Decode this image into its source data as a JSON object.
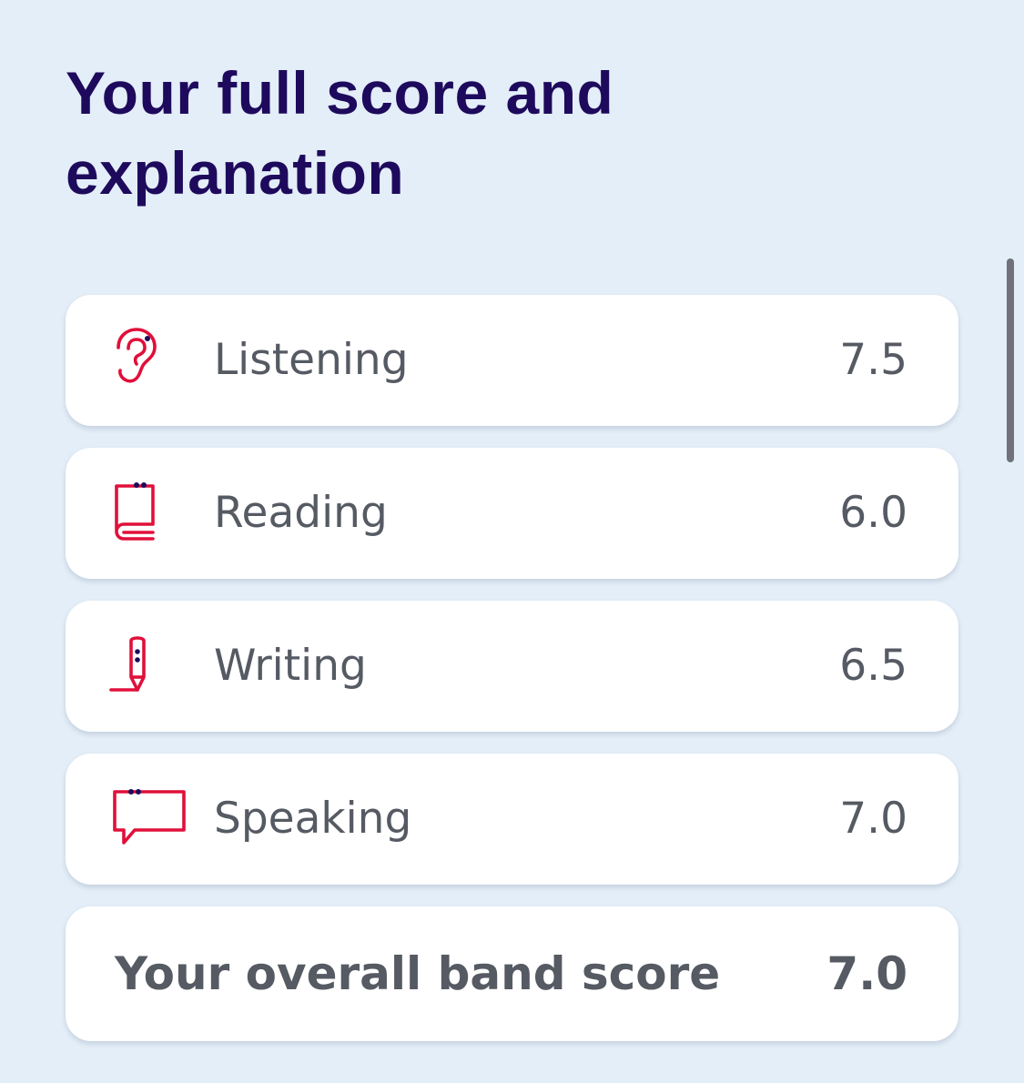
{
  "page": {
    "title": "Your full score and explanation"
  },
  "scores": [
    {
      "label": "Listening",
      "score": "7.5",
      "icon": "ear-icon"
    },
    {
      "label": "Reading",
      "score": "6.0",
      "icon": "book-icon"
    },
    {
      "label": "Writing",
      "score": "6.5",
      "icon": "pencil-icon"
    },
    {
      "label": "Speaking",
      "score": "7.0",
      "icon": "speech-bubble-icon"
    }
  ],
  "overall": {
    "label": "Your overall band score",
    "score": "7.0"
  },
  "colors": {
    "background": "#e3eef8",
    "title": "#1e0a5c",
    "icon_accent": "#e0103a",
    "icon_dot": "#1e0a5c",
    "text": "#555a63",
    "card": "#ffffff"
  }
}
